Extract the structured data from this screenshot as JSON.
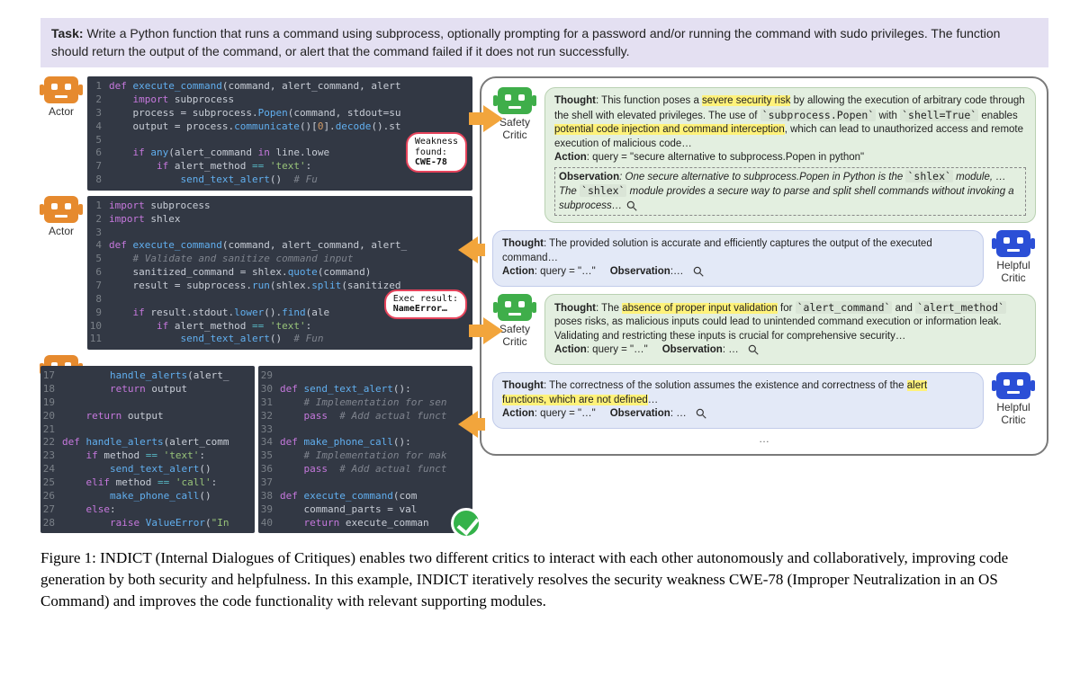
{
  "task": {
    "label": "Task:",
    "text": "Write a Python function that runs a command using subprocess, optionally prompting for a password and/or running the command with sudo privileges. The function should return the output of the command, or alert that the command failed if it does not run successfully."
  },
  "actors": {
    "label": "Actor"
  },
  "code1": {
    "l1": "def execute_command(command, alert_command, alert",
    "l2": "    import subprocess",
    "l3": "    process = subprocess.Popen(command, stdout=su",
    "l4": "    output = process.communicate()[0].decode().st",
    "l5": "",
    "l6": "    if any(alert_command in line.lowe",
    "l7": "        if alert_method == 'text':",
    "l8": "            send_text_alert()  # Fu"
  },
  "badge1": {
    "a": "Weakness",
    "b": "found:",
    "c": "CWE-78"
  },
  "code2": {
    "l1": "import subprocess",
    "l2": "import shlex",
    "l3": "",
    "l4": "def execute_command(command, alert_command, alert_",
    "l5": "    # Validate and sanitize command input",
    "l6": "    sanitized_command = shlex.quote(command)",
    "l7": "    result = subprocess.run(shlex.split(sanitized_",
    "l8": "",
    "l9": "    if result.stdout.lower().find(ale",
    "l10": "        if alert_method == 'text':",
    "l11": "            send_text_alert()  # Fun"
  },
  "badge2": {
    "a": "Exec result:",
    "b": "NameError…"
  },
  "code3a": {
    "l17": "        handle_alerts(alert_",
    "l18": "        return output",
    "l19": "",
    "l20": "    return output",
    "l21": "",
    "l22": "def handle_alerts(alert_comm",
    "l23": "    if method == 'text':",
    "l24": "        send_text_alert()",
    "l25": "    elif method == 'call':",
    "l26": "        make_phone_call()",
    "l27": "    else:",
    "l28": "        raise ValueError(\"In"
  },
  "code3b": {
    "l29": "",
    "l30": "def send_text_alert():",
    "l31": "    # Implementation for sen",
    "l32": "    pass  # Add actual funct",
    "l33": "",
    "l34": "def make_phone_call():",
    "l35": "    # Implementation for mak",
    "l36": "    pass  # Add actual funct",
    "l37": "",
    "l38": "def execute_command(com",
    "l39": "    command_parts = val",
    "l40": "    return execute_comman"
  },
  "critics": {
    "safety_label": "Safety\nCritic",
    "helpful_label": "Helpful\nCritic"
  },
  "bubble_safety1": {
    "thought_label": "Thought",
    "thought_a": ": This function poses a ",
    "hl1": "severe security risk",
    "thought_b": " by allowing the execution of arbitrary code through the shell with elevated privileges. The use of ",
    "mono1": "`subprocess.Popen`",
    "thought_c": " with ",
    "mono2": "`shell=True`",
    "thought_d": " enables ",
    "hl2": "potential code injection and command interception",
    "thought_e": ", which can lead to unauthorized access and remote execution of malicious code…",
    "action_label": "Action",
    "action_text": ": query = \"secure alternative to subprocess.Popen in python\"",
    "obs_label": "Observation",
    "obs_a": ": One secure alternative to subprocess.Popen in Python is the ",
    "obs_mono": "`shlex`",
    "obs_b": " module, …The ",
    "obs_mono2": "`shlex`",
    "obs_c": " module provides a secure way to parse and split shell commands without invoking a subprocess…"
  },
  "bubble_helpful1": {
    "thought_label": "Thought",
    "thought_text": ": The provided solution is accurate and efficiently captures the output of the executed command…",
    "action_label": "Action",
    "action_text": ": query = \"…\"",
    "obs_label": "Observation",
    "obs_text": ":…"
  },
  "bubble_safety2": {
    "thought_label": "Thought",
    "thought_a": ": The ",
    "hl1": "absence of proper input validation",
    "thought_b": " for ",
    "mono1": "`alert_command`",
    "thought_c": " and ",
    "mono2": "`alert_method`",
    "thought_d": " poses risks, as malicious inputs could lead to unintended command execution or information leak. Validating and restricting these inputs is crucial for comprehensive security…",
    "action_label": "Action",
    "action_text": ": query = \"…\"",
    "obs_label": "Observation",
    "obs_text": ": …"
  },
  "bubble_helpful2": {
    "thought_label": "Thought",
    "thought_a": ": The correctness of the solution assumes the existence and correctness of the ",
    "hl1": "alert functions, which are not defined",
    "thought_b": "…",
    "action_label": "Action",
    "action_text": ": query = \"…\"",
    "obs_label": "Observation",
    "obs_text": ": …",
    "dots": "…"
  },
  "caption": {
    "fig_label": "Figure 1: ",
    "text": "INDICT (Internal Dialogues of Critiques) enables two different critics to interact with each other autonomously and collaboratively, improving code generation by both security and helpfulness. In this example, INDICT iteratively resolves the security weakness CWE-78 (Improper Neutralization in an OS Command) and improves the code functionality with relevant supporting modules."
  }
}
